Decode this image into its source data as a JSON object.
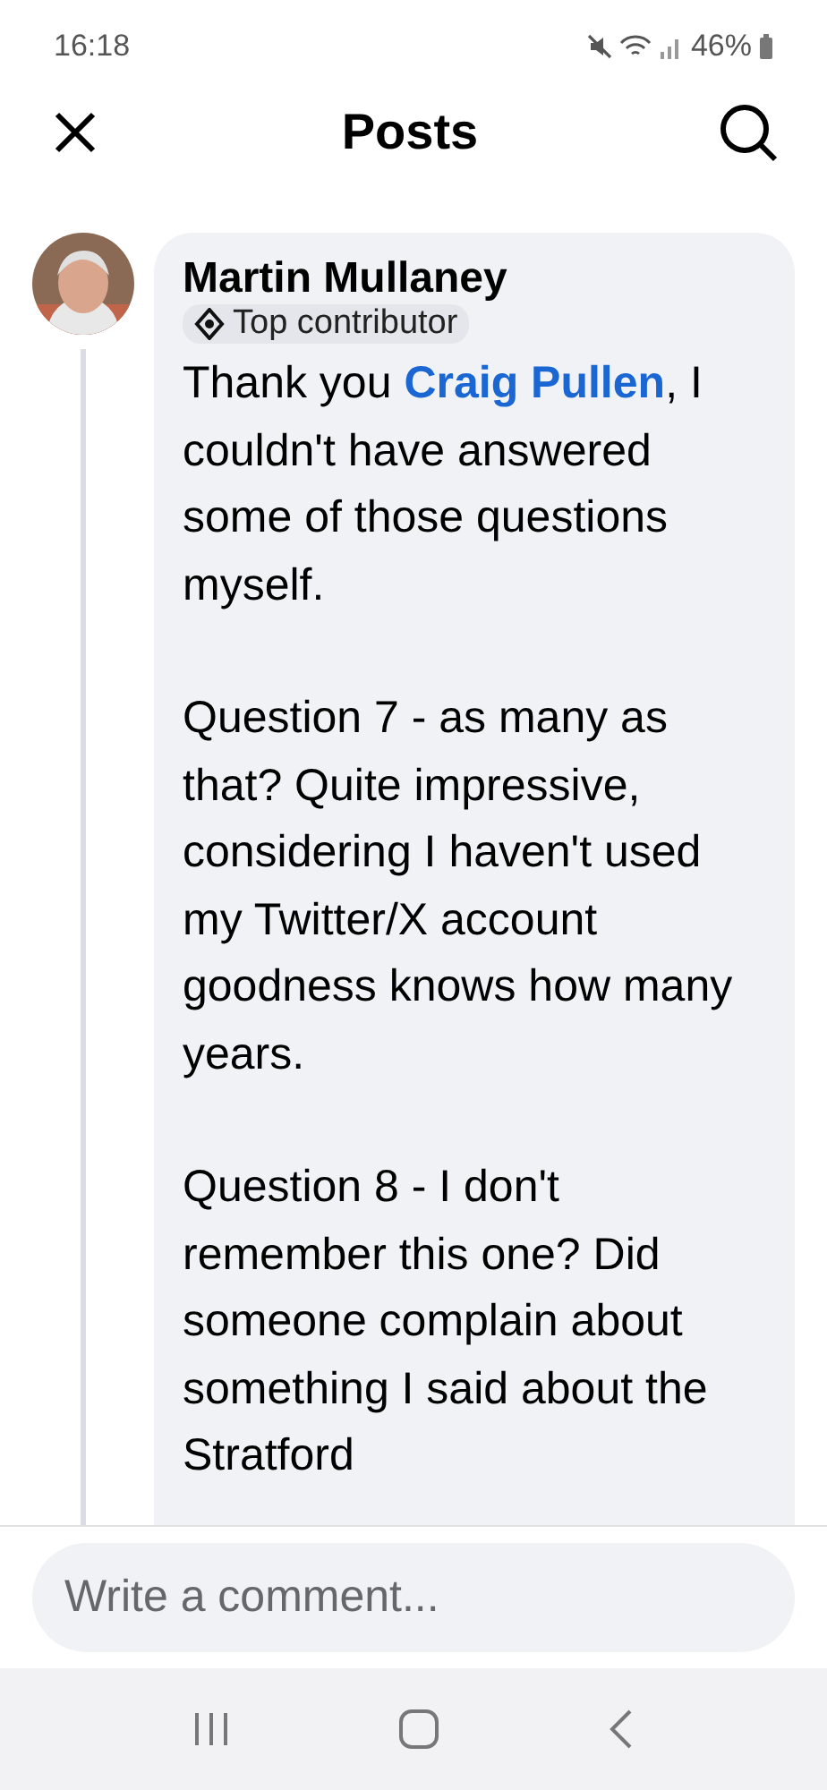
{
  "status_bar": {
    "time": "16:18",
    "battery": "46%"
  },
  "header": {
    "title": "Posts"
  },
  "comment": {
    "author": "Martin Mullaney",
    "badge": "Top contributor",
    "paragraphs": [
      {
        "before": "Thank you ",
        "link": "Craig Pullen",
        "after": ", I couldn't have answered some of those questions myself."
      },
      {
        "before": "Question 7 - as many as that? Quite impressive, considering I haven't used my Twitter/X account goodness knows how many years."
      },
      {
        "before": "Question 8 - I don't remember this one? Did someone complain about something I said about the Stratford"
      }
    ]
  },
  "composer": {
    "placeholder": "Write a comment..."
  }
}
